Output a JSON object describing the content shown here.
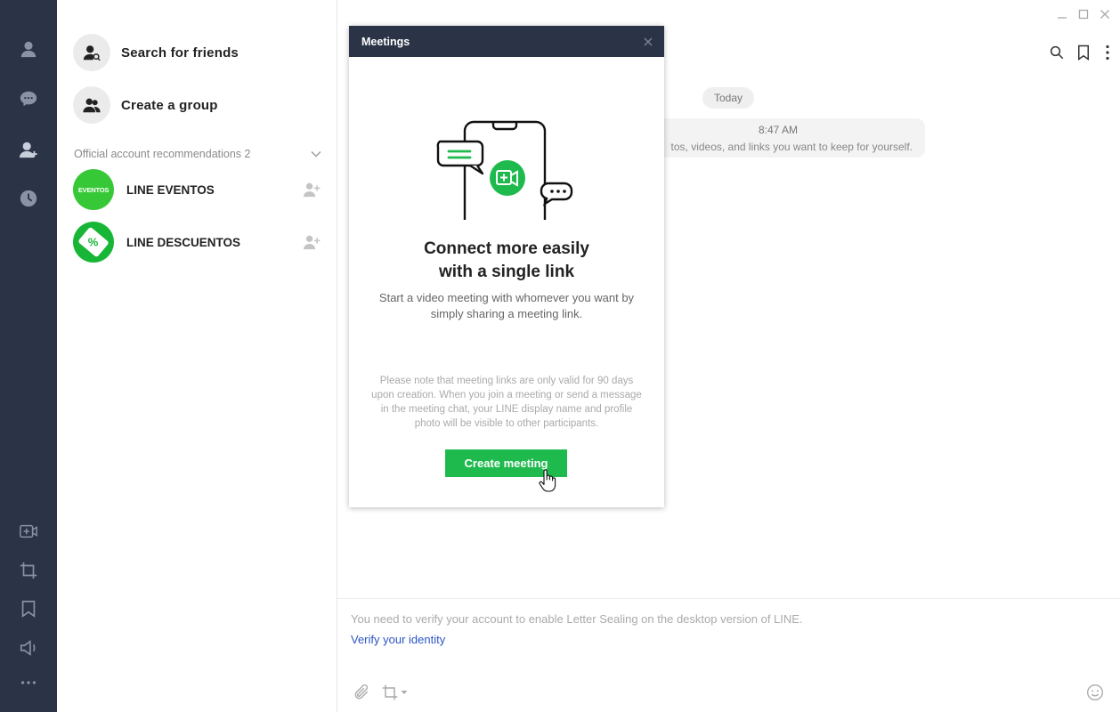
{
  "rail": {
    "top_items": [
      {
        "name": "friends",
        "icon": "person-icon"
      },
      {
        "name": "chats",
        "icon": "chat-bubble-icon"
      },
      {
        "name": "add-friends",
        "icon": "add-person-icon"
      },
      {
        "name": "timeline",
        "icon": "clock-icon"
      }
    ],
    "bottom_items": [
      {
        "name": "meetings",
        "icon": "video-plus-icon"
      },
      {
        "name": "screenshot",
        "icon": "crop-icon"
      },
      {
        "name": "keep",
        "icon": "bookmark-icon"
      },
      {
        "name": "announcements",
        "icon": "speaker-icon"
      },
      {
        "name": "more",
        "icon": "more-dots-icon"
      }
    ]
  },
  "friends": {
    "search_label": "Search for friends",
    "create_group_label": "Create a group",
    "section_title": "Official account recommendations 2",
    "accounts": [
      {
        "name": "LINE EVENTOS",
        "avatar_text": "EVENTOS"
      },
      {
        "name": "LINE DESCUENTOS",
        "avatar_text": "%"
      }
    ]
  },
  "chat": {
    "day_label": "Today",
    "notice_time": "8:47 AM",
    "notice_text": "tos, videos, and links you want to keep for yourself.",
    "composer_message": "You need to verify your account to enable Letter Sealing on the desktop version of LINE.",
    "verify_link": "Verify your identity"
  },
  "dialog": {
    "title": "Meetings",
    "headline": "Connect more easily\nwith a single link",
    "subtext": "Start a video meeting with whomever you want by simply sharing a meeting link.",
    "fine_print": "Please note that meeting links are only valid for 90 days upon creation. When you join a meeting or send a message in the meeting chat, your LINE display name and profile photo will be visible to other participants.",
    "button_label": "Create meeting"
  },
  "colors": {
    "rail_bg": "#2b3346",
    "line_green": "#1fba4e",
    "link_blue": "#2c55c5"
  }
}
